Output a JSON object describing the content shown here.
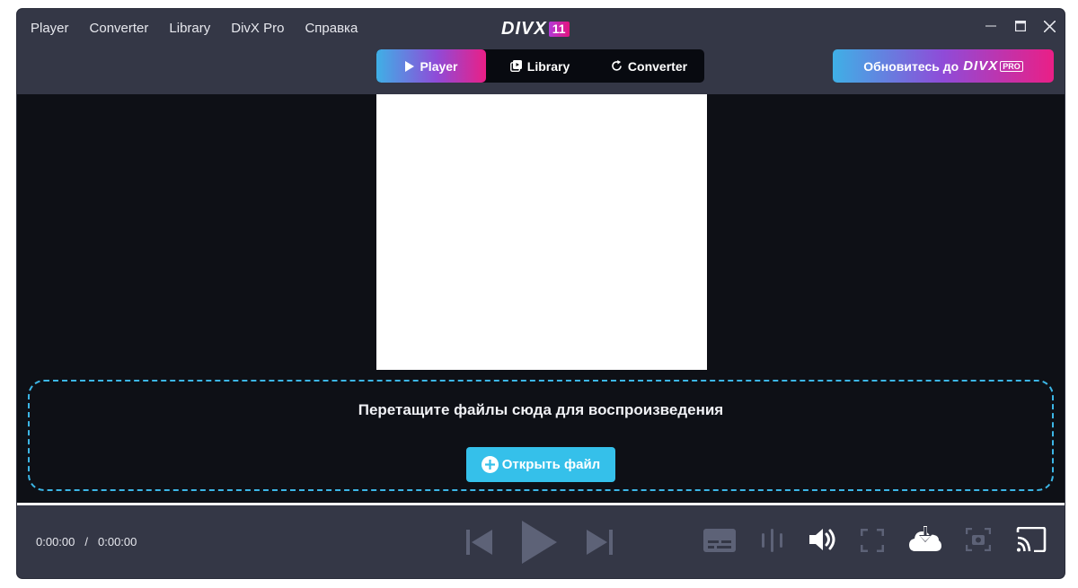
{
  "menu": {
    "items": [
      "Player",
      "Converter",
      "Library",
      "DivX Pro",
      "Справка"
    ]
  },
  "logo": {
    "text": "DIVX",
    "badge": "11"
  },
  "window_controls": {
    "minimize": "minimize-icon",
    "maximize": "maximize-icon",
    "close": "close-icon"
  },
  "mode_tabs": [
    {
      "label": "Player",
      "icon": "play-icon",
      "active": true
    },
    {
      "label": "Library",
      "icon": "library-icon",
      "active": false
    },
    {
      "label": "Converter",
      "icon": "refresh-icon",
      "active": false
    }
  ],
  "upgrade": {
    "label": "Обновитесь до",
    "logo": "DIVX",
    "pro": "PRO"
  },
  "drop_zone": {
    "text": "Перетащите файлы сюда для воспроизведения",
    "open_button": "Открыть файл"
  },
  "playback": {
    "current_time": "0:00:00",
    "separator": "/",
    "total_time": "0:00:00",
    "progress": 0
  },
  "controls": {
    "icons": [
      "previous-icon",
      "play-icon",
      "next-icon",
      "subtitles-icon",
      "audio-track-icon",
      "volume-icon",
      "fullscreen-icon",
      "cloud-download-icon",
      "screenshot-icon",
      "cast-icon"
    ]
  },
  "colors": {
    "window_bg": "#0e1016",
    "bar_bg": "#343746",
    "accent_blue": "#35c0ea",
    "accent_pink": "#ea1f86",
    "dashed_border": "#3cb6e6"
  }
}
